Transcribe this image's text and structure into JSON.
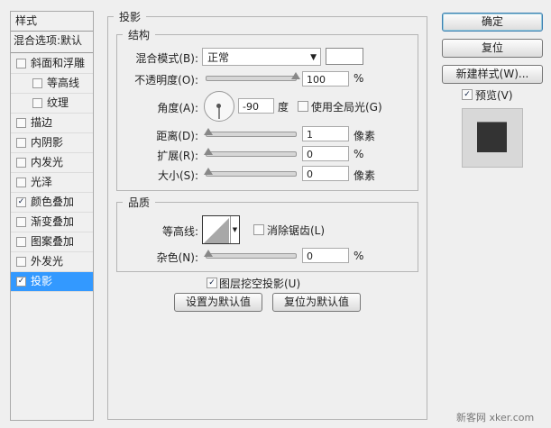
{
  "sidebar": {
    "title": "样式",
    "blend": "混合选项:默认",
    "items": [
      {
        "label": "斜面和浮雕",
        "checked": false,
        "indent": false
      },
      {
        "label": "等高线",
        "checked": false,
        "indent": true
      },
      {
        "label": "纹理",
        "checked": false,
        "indent": true
      },
      {
        "label": "描边",
        "checked": false,
        "indent": false
      },
      {
        "label": "内阴影",
        "checked": false,
        "indent": false
      },
      {
        "label": "内发光",
        "checked": false,
        "indent": false
      },
      {
        "label": "光泽",
        "checked": false,
        "indent": false
      },
      {
        "label": "颜色叠加",
        "checked": true,
        "indent": false
      },
      {
        "label": "渐变叠加",
        "checked": false,
        "indent": false
      },
      {
        "label": "图案叠加",
        "checked": false,
        "indent": false
      },
      {
        "label": "外发光",
        "checked": false,
        "indent": false
      },
      {
        "label": "投影",
        "checked": true,
        "indent": false,
        "selected": true
      }
    ]
  },
  "main": {
    "title": "投影",
    "structure": {
      "title": "结构",
      "blend_label": "混合模式(B):",
      "blend_value": "正常",
      "opacity_label": "不透明度(O):",
      "opacity": "100",
      "pct": "%",
      "angle_label": "角度(A):",
      "angle": "-90",
      "deg": "度",
      "global_light": "使用全局光(G)",
      "distance_label": "距离(D):",
      "distance": "1",
      "px": "像素",
      "spread_label": "扩展(R):",
      "spread": "0",
      "size_label": "大小(S):",
      "size": "0"
    },
    "quality": {
      "title": "品质",
      "contour_label": "等高线:",
      "antialias": "消除锯齿(L)",
      "noise_label": "杂色(N):",
      "noise": "0",
      "pct": "%"
    },
    "knockout": "图层挖空投影(U)",
    "set_default": "设置为默认值",
    "reset_default": "复位为默认值"
  },
  "right": {
    "ok": "确定",
    "reset": "复位",
    "new_style": "新建样式(W)...",
    "preview": "预览(V)"
  },
  "watermark": "新客网 xker.com"
}
